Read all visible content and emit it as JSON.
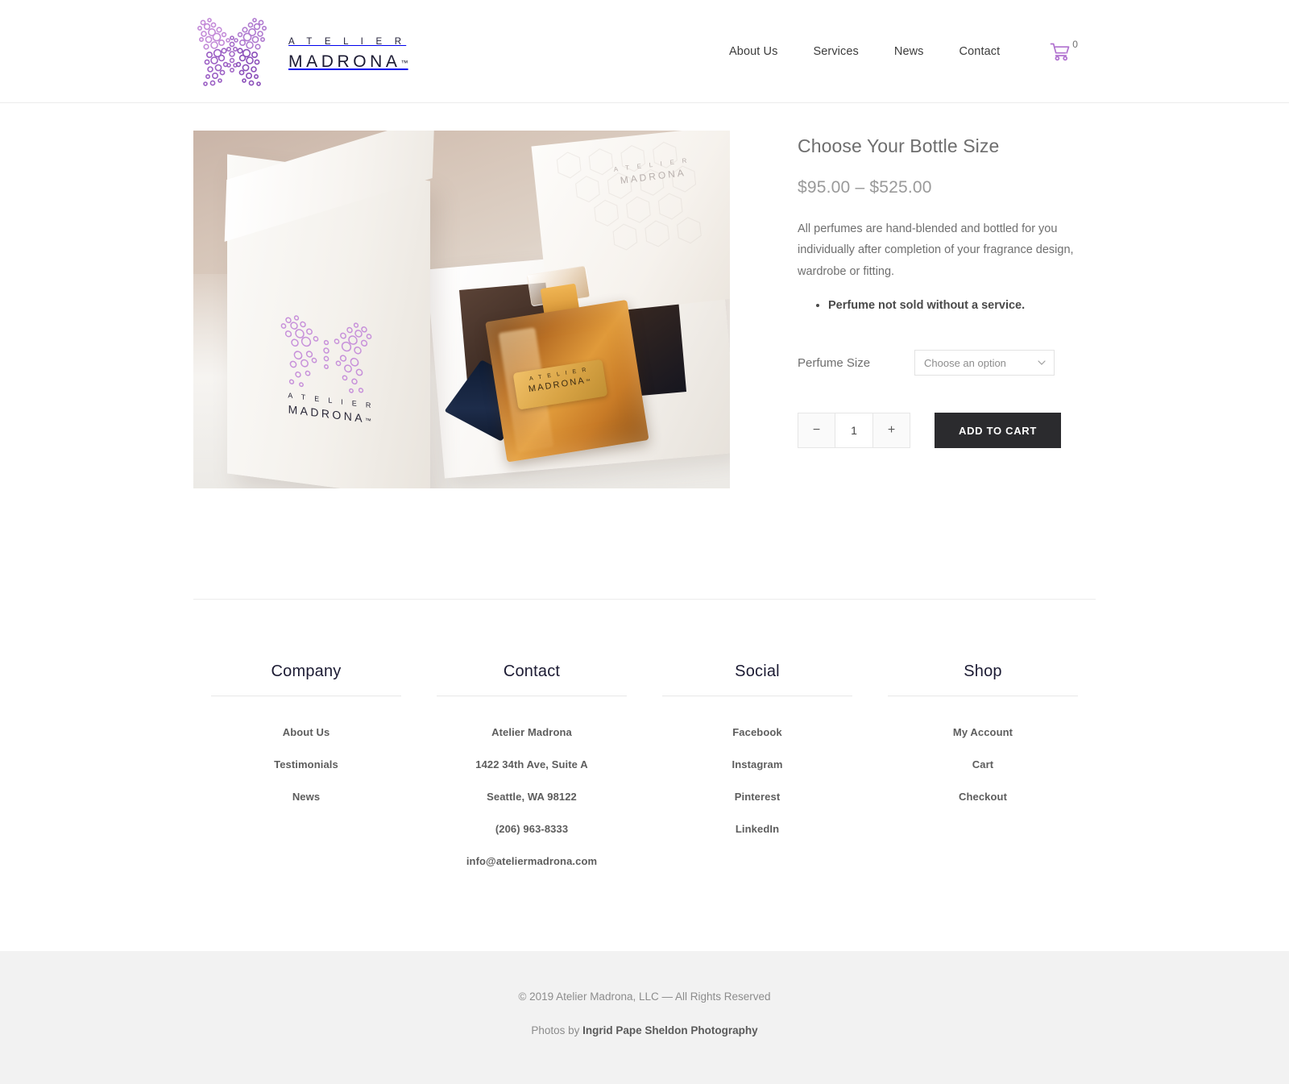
{
  "header": {
    "logo_icon": "butterfly-dots-logo",
    "brand_top": "A T E L I E R",
    "brand_main": "MADRONA",
    "brand_tm": "™",
    "nav": [
      {
        "label": "About Us"
      },
      {
        "label": "Services"
      },
      {
        "label": "News"
      },
      {
        "label": "Contact"
      }
    ],
    "cart_icon": "shopping-cart-icon",
    "cart_count": "0"
  },
  "product": {
    "image_alt": "Amber perfume bottle with gold Atelier Madrona label inside open white gift box",
    "image_label_top": "A T E L I E R",
    "image_label_main": "MADRONA",
    "image_label_tm": "™",
    "box_label_top": "A T E L I E R",
    "box_label_main": "MADRONA",
    "lid_label_top": "A T E L I E R",
    "lid_label_main": "MADRONA",
    "title": "Choose Your Bottle Size",
    "price": "$95.00 – $525.00",
    "description": "All perfumes are hand-blended and bottled for you individually after completion of your fragrance design, wardrobe or fitting.",
    "bullets": [
      "Perfume not sold without a service."
    ],
    "variation_label": "Perfume Size",
    "variation_selected": "Choose an option",
    "chevron_icon": "chevron-down-icon",
    "qty_minus": "−",
    "qty_value": "1",
    "qty_plus": "+",
    "add_to_cart": "ADD TO CART"
  },
  "footer": {
    "columns": [
      {
        "title": "Company",
        "items": [
          {
            "label": "About Us",
            "link": true
          },
          {
            "label": "Testimonials",
            "link": true
          },
          {
            "label": "News",
            "link": true
          }
        ]
      },
      {
        "title": "Contact",
        "items": [
          {
            "label": "Atelier Madrona",
            "link": false
          },
          {
            "label": "1422 34th Ave, Suite A",
            "link": false
          },
          {
            "label": "Seattle, WA 98122",
            "link": false
          },
          {
            "label": "(206) 963-8333",
            "link": false
          },
          {
            "label": "info@ateliermadrona.com",
            "link": true
          }
        ]
      },
      {
        "title": "Social",
        "items": [
          {
            "label": "Facebook",
            "link": true
          },
          {
            "label": "Instagram",
            "link": true
          },
          {
            "label": "Pinterest",
            "link": true
          },
          {
            "label": "LinkedIn",
            "link": true
          }
        ]
      },
      {
        "title": "Shop",
        "items": [
          {
            "label": "My Account",
            "link": true
          },
          {
            "label": "Cart",
            "link": true
          },
          {
            "label": "Checkout",
            "link": true
          }
        ]
      }
    ]
  },
  "copyright": {
    "line1": "© 2019 Atelier Madrona, LLC — All Rights Reserved",
    "line2_prefix": "Photos by ",
    "line2_bold": "Ingrid Pape Sheldon Photography"
  },
  "colors": {
    "brand_purple": "#b071cf",
    "logo_violet": "#9b59b6",
    "dark_navy": "#1c1b33",
    "button_dark": "#2b2b2e",
    "gray_bar": "#f2f2f2"
  }
}
